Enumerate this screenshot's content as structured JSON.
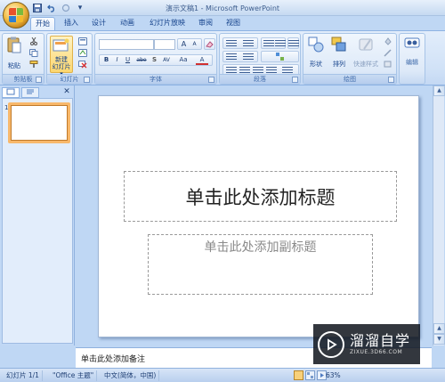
{
  "window": {
    "title": "演示文稿1 - Microsoft PowerPoint"
  },
  "qat": {
    "save": "save-icon",
    "undo": "undo-icon",
    "redo": "redo-icon",
    "customize": "▾"
  },
  "tabs": [
    {
      "label": "开始",
      "active": true
    },
    {
      "label": "插入"
    },
    {
      "label": "设计"
    },
    {
      "label": "动画"
    },
    {
      "label": "幻灯片放映"
    },
    {
      "label": "审阅"
    },
    {
      "label": "视图"
    }
  ],
  "ribbon": {
    "clipboard": {
      "label": "剪贴板",
      "paste": "粘贴"
    },
    "slides": {
      "label": "幻灯片",
      "new_slide_line1": "新建",
      "new_slide_line2": "幻灯片 ▾"
    },
    "font": {
      "label": "字体",
      "grow": "A",
      "shrink": "A",
      "bold": "B",
      "italic": "I",
      "underline": "U",
      "strike": "abe",
      "shadow": "S",
      "spacing": "AV",
      "case": "Aa",
      "color": "A"
    },
    "paragraph": {
      "label": "段落"
    },
    "drawing": {
      "label": "绘图",
      "shapes": "形状",
      "arrange": "排列",
      "quick_styles": "快速样式"
    },
    "editing": {
      "label": "编辑"
    }
  },
  "left_panel": {
    "close": "✕",
    "slide_number": "1"
  },
  "slide": {
    "title_placeholder": "单击此处添加标题",
    "subtitle_placeholder": "单击此处添加副标题"
  },
  "notes": {
    "placeholder": "单击此处添加备注"
  },
  "status": {
    "slide": "幻灯片 1/1",
    "theme": "\"Office 主题\"",
    "language": "中文(简体，中国)",
    "zoom": "63%"
  },
  "watermark": {
    "name": "溜溜自学",
    "url": "ZIXUE.3D66.COM"
  },
  "colors": {
    "accent_orange": "#f8b86b",
    "ribbon_blue": "#dde9f8",
    "text_blue": "#15428b"
  }
}
